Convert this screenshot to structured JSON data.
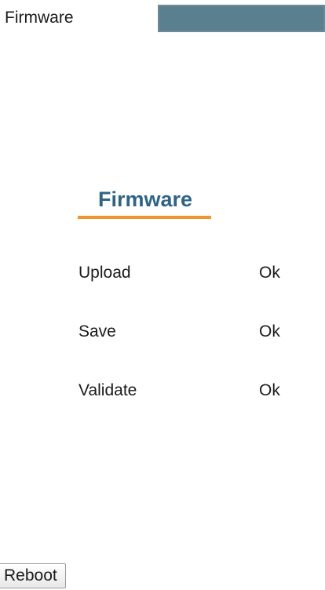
{
  "topbar": {
    "tab_label": "Firmware",
    "highlight_color": "#5a7f8f"
  },
  "panel": {
    "title": "Firmware",
    "title_color": "#2f6486",
    "underline_color": "#f0962b",
    "steps": [
      {
        "label": "Upload",
        "status": "Ok"
      },
      {
        "label": "Save",
        "status": "Ok"
      },
      {
        "label": "Validate",
        "status": "Ok"
      }
    ]
  },
  "actions": {
    "reboot_label": "Reboot"
  }
}
